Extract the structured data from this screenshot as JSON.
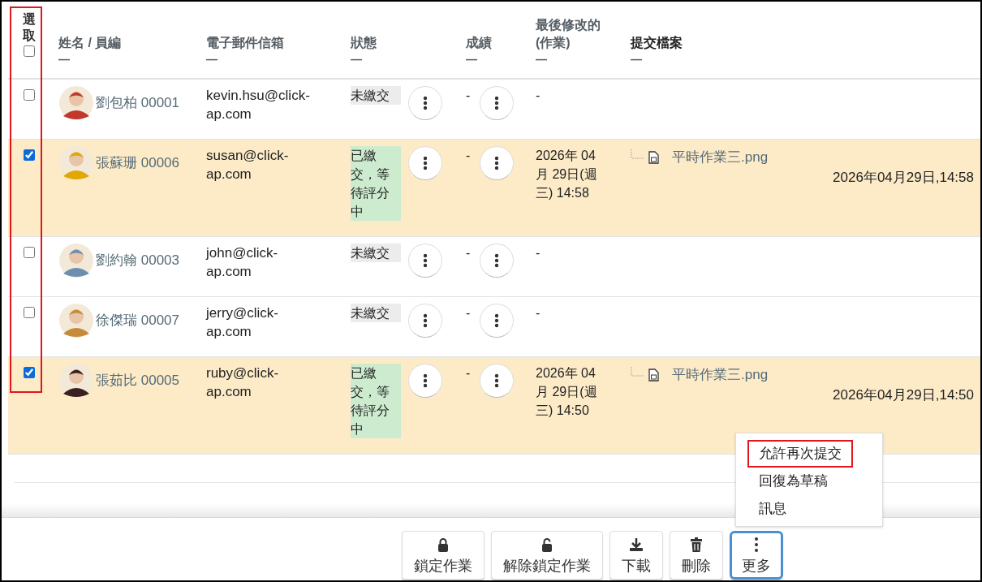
{
  "table": {
    "select_header": {
      "label": "選取",
      "checked": false,
      "highlighted": true
    },
    "columns": [
      {
        "label": "姓名 / 員編",
        "sort": "—"
      },
      {
        "label": "電子郵件信箱",
        "sort": "—"
      },
      {
        "label": "狀態",
        "sort": "—"
      },
      {
        "label": "成績",
        "sort": "—"
      },
      {
        "label": "最後修改的 (作業)",
        "sort": "—"
      },
      {
        "label": "提交檔案",
        "sort": "—"
      }
    ],
    "rows": [
      {
        "checked": false,
        "name": "劉包柏 00001",
        "email": "kevin.hsu@click-ap.com",
        "status": {
          "kind": "missing",
          "label": "未繳交"
        },
        "grade": "-",
        "modified": "-"
      },
      {
        "checked": true,
        "name": "張蘇珊 00006",
        "email": "susan@click-ap.com",
        "status": {
          "kind": "submitted",
          "label": "已繳交，等待評分中"
        },
        "grade": "-",
        "modified": "2026年 04 月 29日(週三) 14:58",
        "file": {
          "name": "平時作業三.png",
          "date": "2026年04月29日,14:58"
        }
      },
      {
        "checked": false,
        "name": "劉約翰 00003",
        "email": "john@click-ap.com",
        "status": {
          "kind": "missing",
          "label": "未繳交"
        },
        "grade": "-",
        "modified": "-"
      },
      {
        "checked": false,
        "name": "徐傑瑞 00007",
        "email": "jerry@click-ap.com",
        "status": {
          "kind": "missing",
          "label": "未繳交"
        },
        "grade": "-",
        "modified": "-"
      },
      {
        "checked": true,
        "name": "張茹比 00005",
        "email": "ruby@click-ap.com",
        "status": {
          "kind": "submitted",
          "label": "已繳交，等待評分中"
        },
        "grade": "-",
        "modified": "2026年 04 月 29日(週三) 14:50",
        "file": {
          "name": "平時作業三.png",
          "date": "2026年04月29日,14:50"
        }
      }
    ]
  },
  "menu": {
    "items": [
      {
        "label": "允許再次提交",
        "highlighted": true
      },
      {
        "label": "回復為草稿",
        "highlighted": false
      },
      {
        "label": "訊息",
        "highlighted": false
      }
    ]
  },
  "toolbar": [
    {
      "kind": "lock",
      "label": "鎖定作業",
      "focused": false
    },
    {
      "kind": "unlock",
      "label": "解除鎖定作業",
      "focused": false
    },
    {
      "kind": "download",
      "label": "下載",
      "focused": false
    },
    {
      "kind": "delete",
      "label": "刪除",
      "focused": false
    },
    {
      "kind": "more",
      "label": "更多",
      "focused": true
    }
  ]
}
